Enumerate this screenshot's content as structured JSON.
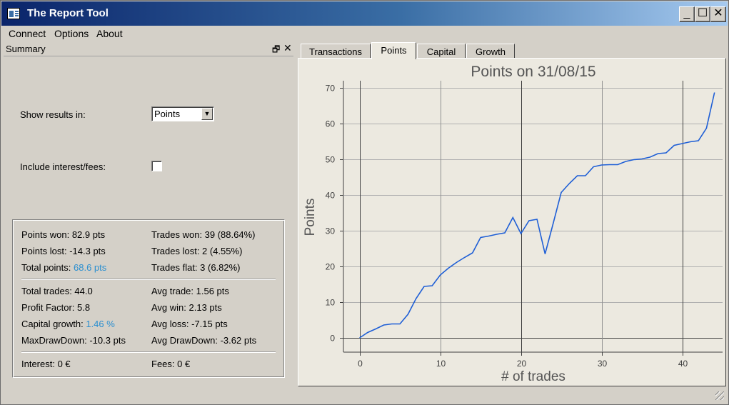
{
  "window": {
    "title": "The Report Tool",
    "controls": {
      "minimize": "_",
      "maximize": "☐",
      "close": "✕"
    }
  },
  "menu": [
    "Connect",
    "Options",
    "About"
  ],
  "dock": {
    "title": "Summary",
    "show_results_label": "Show results in:",
    "show_results_value": "Points",
    "include_label": "Include interest/fees:",
    "include_checked": false,
    "stats": {
      "points_won": "Points won: 82.9 pts",
      "trades_won": "Trades won: 39 (88.64%)",
      "points_lost": "Points lost: -14.3 pts",
      "trades_lost": "Trades lost: 2 (4.55%)",
      "total_points_label": "Total points:",
      "total_points_value": "68.6 pts",
      "trades_flat": "Trades flat: 3 (6.82%)",
      "total_trades": "Total trades: 44.0",
      "avg_trade": "Avg trade: 1.56 pts",
      "profit_factor": "Profit Factor: 5.8",
      "avg_win": "Avg win: 2.13 pts",
      "capital_growth_label": "Capital growth:",
      "capital_growth_value": "1.46 %",
      "avg_loss": "Avg loss: -7.15 pts",
      "max_drawdown": "MaxDrawDown: -10.3 pts",
      "avg_drawdown": "Avg DrawDown: -3.62 pts",
      "interest": "Interest: 0 €",
      "fees": "Fees: 0 €"
    }
  },
  "tabs": [
    "Transactions",
    "Points",
    "Capital",
    "Growth"
  ],
  "active_tab": "Points",
  "colors": {
    "line": "#1f5fd6",
    "highlight": "#2b8fd0"
  },
  "chart_data": {
    "type": "line",
    "title": "Points on 31/08/15",
    "xlabel": "# of trades",
    "ylabel": "Points",
    "xlim": [
      -2,
      45
    ],
    "ylim": [
      -4,
      72
    ],
    "xticks": [
      0,
      10,
      20,
      30,
      40
    ],
    "yticks": [
      0,
      10,
      20,
      30,
      40,
      50,
      60,
      70
    ],
    "grid": true,
    "series": [
      {
        "x": [
          0,
          1,
          2,
          3,
          4,
          5,
          6,
          7,
          8,
          9,
          10,
          11,
          12,
          13,
          14,
          15,
          16,
          17,
          18,
          19,
          20,
          21,
          22,
          23,
          24,
          25,
          26,
          27,
          28,
          29,
          30,
          31,
          32,
          33,
          34,
          35,
          36,
          37,
          38,
          39,
          40,
          41,
          42,
          43,
          44
        ],
        "values": [
          0,
          1.5,
          2.5,
          3.6,
          3.9,
          3.9,
          6.6,
          11,
          14.4,
          14.6,
          17.6,
          19.5,
          21.1,
          22.5,
          23.8,
          28.1,
          28.5,
          29,
          29.4,
          33.7,
          29.2,
          32.8,
          33.2,
          23.5,
          32,
          40.7,
          43.2,
          45.4,
          45.4,
          47.9,
          48.4,
          48.5,
          48.5,
          49.4,
          49.9,
          50.1,
          50.6,
          51.6,
          51.8,
          53.9,
          54.4,
          54.9,
          55.2,
          58.7,
          68.7
        ]
      }
    ]
  }
}
